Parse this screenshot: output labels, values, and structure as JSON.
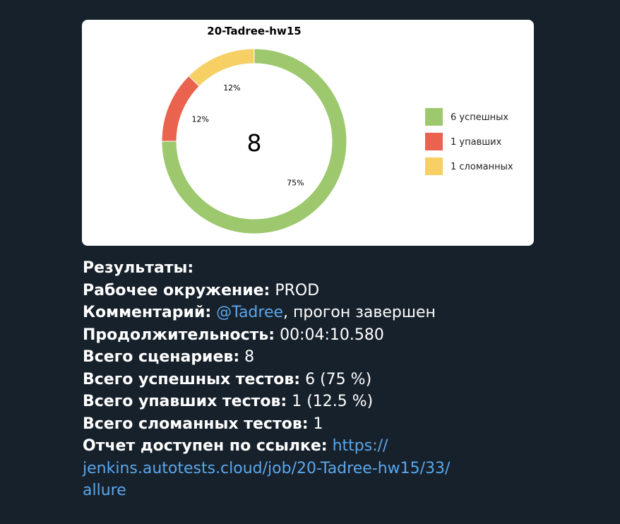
{
  "chart_data": {
    "type": "pie",
    "title": "20-Tadree-hw15",
    "center_label": "8",
    "slices": [
      {
        "legend": "6 успешных",
        "value": 6,
        "percent_label": "75%",
        "color": "#9dc86d"
      },
      {
        "legend": "1 упавших",
        "value": 1,
        "percent_label": "12%",
        "color": "#e9634e"
      },
      {
        "legend": "1 сломанных",
        "value": 1,
        "percent_label": "12%",
        "color": "#f6cf65"
      }
    ],
    "legend_position": "right"
  },
  "message": {
    "results_label": "Результаты:",
    "env_label": "Рабочее окружение:",
    "env_value": " PROD",
    "comment_label": "Комментарий:",
    "comment_mention": "@Tadree",
    "comment_value": ", прогон завершен",
    "duration_label": "Продолжительность:",
    "duration_value": " 00:04:10.580",
    "scenarios_label": "Всего сценариев:",
    "scenarios_value": " 8",
    "passed_label": "Всего успешных тестов:",
    "passed_value": " 6 (75 %)",
    "failed_label": "Всего упавших тестов:",
    "failed_value": " 1 (12.5 %)",
    "broken_label": "Всего сломанных тестов:",
    "broken_value": " 1",
    "report_label": "Отчет доступен по ссылке:",
    "report_link_line1": "https://",
    "report_link_line2": "jenkins.autotests.cloud/job/20-Tadree-hw15/33/",
    "report_link_line3": "allure"
  }
}
